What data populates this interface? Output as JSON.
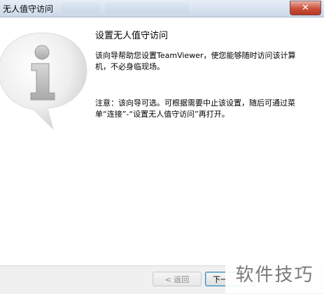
{
  "window": {
    "title": "无人值守访问",
    "close_glyph": "✕"
  },
  "content": {
    "heading": "设置无人值守访问",
    "paragraph1": "该向导帮助您设置TeamViewer，使您能够随时访问该计算机，不必身临现场。",
    "paragraph2": "注意：该向导可选。可根据需要中止该设置，随后可通过菜单“连接”-“设置无人值守访问”再打开。",
    "info_icon": "info-bubble-icon"
  },
  "footer": {
    "back_label": "< 返回",
    "next_label": "下一"
  },
  "watermark": {
    "text": "软件技巧"
  }
}
